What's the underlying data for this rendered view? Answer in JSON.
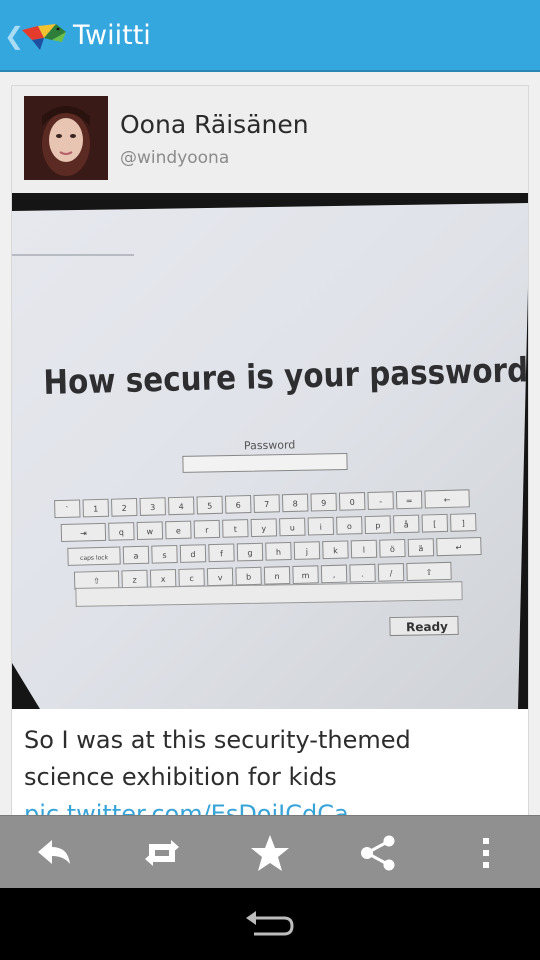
{
  "action_bar": {
    "title": "Twiitti",
    "accent_color": "#35a7df",
    "logo_icon": "hummingbird-logo-icon",
    "up_icon": "chevron-left-icon"
  },
  "tweet": {
    "author_name": "Oona Räisänen",
    "author_handle": "@windyoona",
    "text": "So I was at this security-themed science exhibition for kids ",
    "link_text": "pic.twitter.com/EsDoiJCdCa",
    "link_color": "#37a4d8",
    "photo": {
      "headline": "How secure is your password?",
      "field_label": "Password",
      "ready_label": "Ready",
      "key_rows": [
        [
          "`",
          "1",
          "2",
          "3",
          "4",
          "5",
          "6",
          "7",
          "8",
          "9",
          "0",
          "-",
          "=",
          "←"
        ],
        [
          "⇥",
          "q",
          "w",
          "e",
          "r",
          "t",
          "y",
          "u",
          "i",
          "o",
          "p",
          "å",
          "[",
          "]"
        ],
        [
          "caps lock",
          "a",
          "s",
          "d",
          "f",
          "g",
          "h",
          "j",
          "k",
          "l",
          "ö",
          "ä",
          "↵"
        ],
        [
          "⇧",
          "z",
          "x",
          "c",
          "v",
          "b",
          "n",
          "m",
          ",",
          ".",
          "/",
          "⇧"
        ]
      ]
    }
  },
  "toolbar": {
    "icons": [
      "reply-icon",
      "retweet-icon",
      "star-icon",
      "share-icon",
      "overflow-menu-icon"
    ]
  },
  "nav": {
    "back_icon": "back-arrow-icon"
  }
}
